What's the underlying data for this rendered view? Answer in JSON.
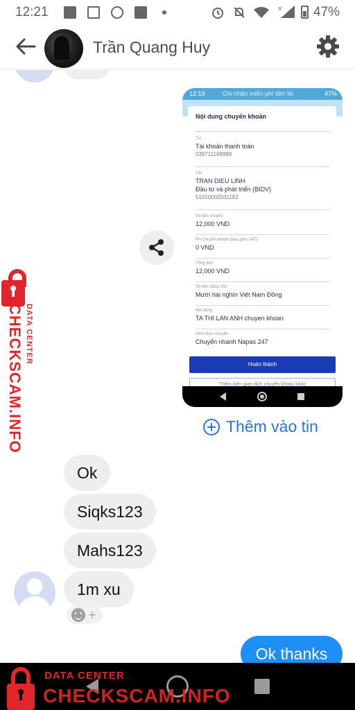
{
  "status_bar": {
    "time": "12:21",
    "battery_percent": "47%",
    "battery_level": 0.47,
    "icons": [
      "image-notification-icon",
      "news-notification-icon",
      "messenger-notification-icon",
      "app-notification-icon",
      "alarm-icon",
      "mute-icon",
      "wifi-icon",
      "signal-icon",
      "battery-icon"
    ]
  },
  "header": {
    "contact_name": "Trần Quang Huy",
    "back_icon": "arrow-left-icon",
    "settings_icon": "gear-icon"
  },
  "shared_image": {
    "status_time": "12:19",
    "status_notif": "Ghi nhận miễn phí tiền lôi",
    "status_pct": "47%",
    "title": "Nội dung chuyển khoản",
    "fields": [
      {
        "label": "Từ",
        "lines": [
          "Tài khoản thanh toán",
          "039711169999"
        ]
      },
      {
        "label": "Tới",
        "lines": [
          "TRAN DIEU LINH",
          "Đầu tư và phát triển (BIDV)",
          "51010002031182"
        ]
      },
      {
        "label": "Số tiền chuyển",
        "lines": [
          "12,000 VND"
        ]
      },
      {
        "label": "Phí chuyển khoản (bao gồm VAT)",
        "lines": [
          "0 VND"
        ]
      },
      {
        "label": "Tổng tiền",
        "lines": [
          "12,000 VND"
        ]
      },
      {
        "label": "Số tiền bằng chữ",
        "lines": [
          "Mười hai nghìn Việt Nam Đồng"
        ]
      },
      {
        "label": "Nội dung",
        "lines": [
          "TA THI LAN ANH chuyen khoan"
        ]
      },
      {
        "label": "Hình thức chuyển",
        "lines": [
          "Chuyển nhanh Napas 247"
        ]
      }
    ],
    "primary_button": "Hoàn thành",
    "secondary_button": "Thêm kiện giao dịch chuyển khoản khác"
  },
  "share_button": {
    "icon": "share-icon"
  },
  "add_to_story": {
    "label": "Thêm vào tin",
    "icon": "plus-circle-icon"
  },
  "messages_incoming": [
    "Ok",
    "Siqks123",
    "Mahs123",
    "1m xu"
  ],
  "reaction_picker": {
    "icon": "smile-icon",
    "add": "+"
  },
  "message_outgoing": "Ok thanks",
  "watermark": {
    "side_big": "CHECKSCAM.INFO",
    "side_small": "DATA CENTER",
    "bottom_small": "DATA CENTER",
    "bottom_big": "CHECKSCAM.INFO",
    "color": "#e2242b"
  },
  "colors": {
    "accent": "#1f8ef5",
    "link": "#2a74d6",
    "incoming_bubble": "#eeeeee"
  }
}
